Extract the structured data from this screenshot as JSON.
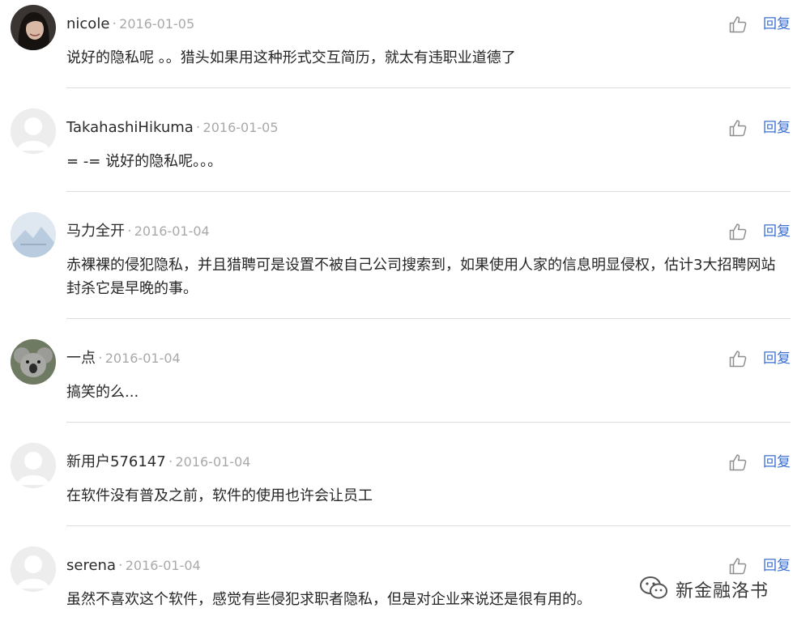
{
  "comments": [
    {
      "user": "nicole",
      "date": "2016-01-05",
      "text": "说好的隐私呢 。。猎头如果用这种形式交互简历，就太有违职业道德了",
      "reply": "回复",
      "avatar": "photo-woman-avatar"
    },
    {
      "user": "TakahashiHikuma",
      "date": "2016-01-05",
      "text": "= -= 说好的隐私呢。。。",
      "reply": "回复",
      "avatar": "default-avatar"
    },
    {
      "user": "马力全开",
      "date": "2016-01-04",
      "text": "赤裸裸的侵犯隐私，并且猎聘可是设置不被自己公司搜索到，如果使用人家的信息明显侵权，估计3大招聘网站封杀它是早晚的事。",
      "reply": "回复",
      "avatar": "mountain-avatar"
    },
    {
      "user": "一点",
      "date": "2016-01-04",
      "text": "搞笑的么...",
      "reply": "回复",
      "avatar": "koala-avatar"
    },
    {
      "user": "新用户576147",
      "date": "2016-01-04",
      "text": "在软件没有普及之前，软件的使用也许会让员工",
      "reply": "回复",
      "avatar": "default-avatar"
    },
    {
      "user": "serena",
      "date": "2016-01-04",
      "text": "虽然不喜欢这个软件，感觉有些侵犯求职者隐私，但是对企业来说还是很有用的。",
      "reply": "回复",
      "avatar": "default-avatar"
    }
  ],
  "separator": "·",
  "watermark": {
    "text": "新金融洛书",
    "icon": "wechat-icon"
  },
  "colors": {
    "reply": "#3b6fd0",
    "date": "#a9a9a9",
    "divider": "#dcdcdc"
  }
}
